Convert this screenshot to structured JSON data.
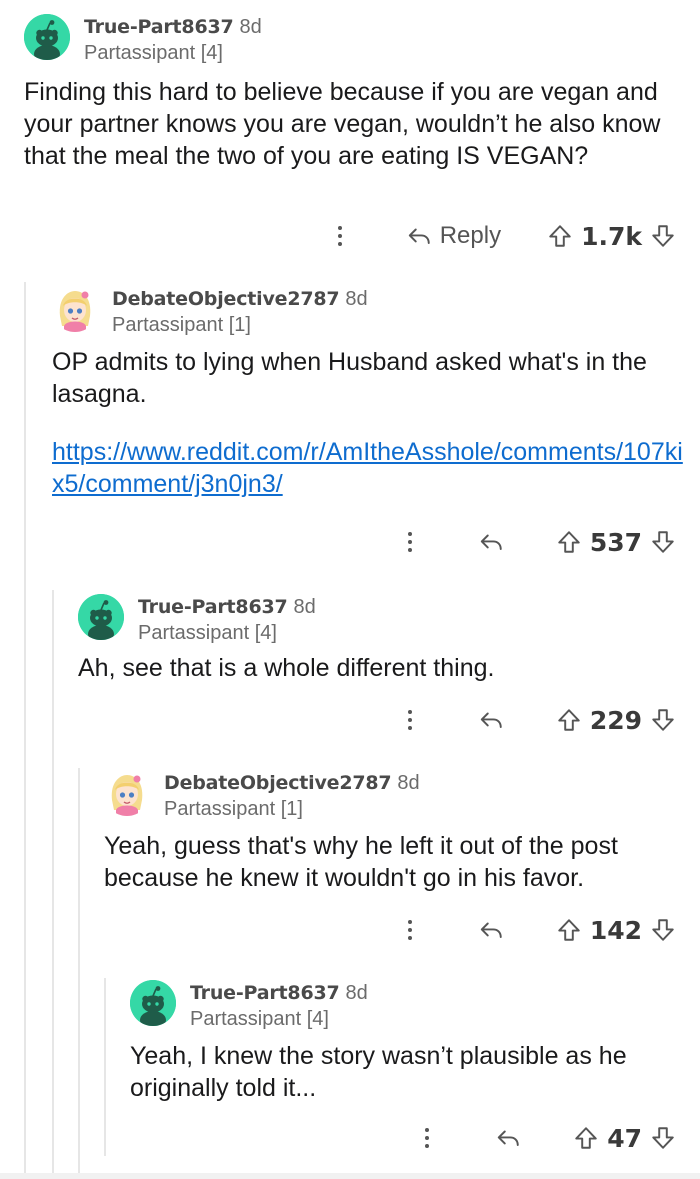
{
  "icons": {
    "avatar_snoo": "reddit-default-avatar-icon",
    "avatar_anime": "anime-girl-avatar-icon",
    "more": "more-options-icon",
    "reply": "reply-arrow-icon",
    "upvote": "upvote-arrow-icon",
    "downvote": "downvote-arrow-icon"
  },
  "colors": {
    "snoo_bg": "#35d8a6",
    "link": "#0e6ccf",
    "text": "#1a1a1b",
    "meta": "#6b6b6b"
  },
  "comments": [
    {
      "username": "True-Part8637",
      "age": "8d",
      "flair": "Partassipant [4]",
      "body": "Finding this hard to believe because if you are vegan and your partner knows you are vegan, wouldn’t he also know that the meal the two of you are eating IS VEGAN?",
      "reply_label": "Reply",
      "score": "1.7k"
    },
    {
      "username": "DebateObjective2787",
      "age": "8d",
      "flair": "Partassipant [1]",
      "body": "OP admits to lying when Husband asked what's in the lasagna.",
      "link": "https://www.reddit.com/r/AmItheAsshole/comments/107kix5/comment/j3n0jn3/",
      "score": "537"
    },
    {
      "username": "True-Part8637",
      "age": "8d",
      "flair": "Partassipant [4]",
      "body": "Ah, see that is a whole different thing.",
      "score": "229"
    },
    {
      "username": "DebateObjective2787",
      "age": "8d",
      "flair": "Partassipant [1]",
      "body": "Yeah, guess that's why he left it out of the post because he knew it wouldn't go in his favor.",
      "score": "142"
    },
    {
      "username": "True-Part8637",
      "age": "8d",
      "flair": "Partassipant [4]",
      "body": "Yeah, I knew the story wasn’t plausible as he originally told it...",
      "score": "47"
    }
  ]
}
